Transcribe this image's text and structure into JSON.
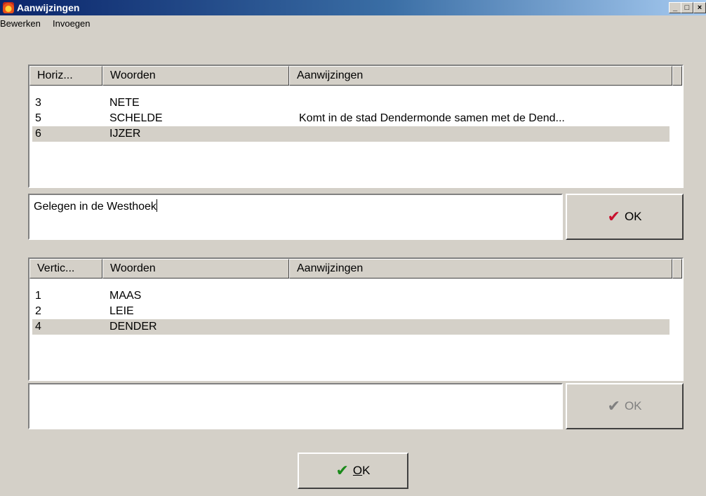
{
  "window": {
    "title": "Aanwijzingen",
    "minimize": "_",
    "maximize": "□",
    "close": "×"
  },
  "menu": {
    "items": [
      "Bewerken",
      "Invoegen"
    ]
  },
  "horizontal": {
    "headers": [
      "Horiz...",
      "Woorden",
      "Aanwijzingen"
    ],
    "rows": [
      {
        "num": "3",
        "word": "NETE",
        "clue": ""
      },
      {
        "num": "5",
        "word": "SCHELDE",
        "clue": "Komt in de stad Dendermonde samen met de Dend..."
      },
      {
        "num": "6",
        "word": "IJZER",
        "clue": ""
      }
    ],
    "input_value": "Gelegen in de Westhoek",
    "ok_label": "OK"
  },
  "vertical": {
    "headers": [
      "Vertic...",
      "Woorden",
      "Aanwijzingen"
    ],
    "rows": [
      {
        "num": "1",
        "word": "MAAS",
        "clue": ""
      },
      {
        "num": "2",
        "word": "LEIE",
        "clue": ""
      },
      {
        "num": "4",
        "word": "DENDER",
        "clue": ""
      }
    ],
    "input_value": "",
    "ok_label": "OK"
  },
  "main_ok": {
    "underlined": "O",
    "rest": "K"
  },
  "icons": {
    "check_icon": "✔",
    "check_color_red": "#c8102e",
    "check_color_green": "#1a8a1a"
  }
}
